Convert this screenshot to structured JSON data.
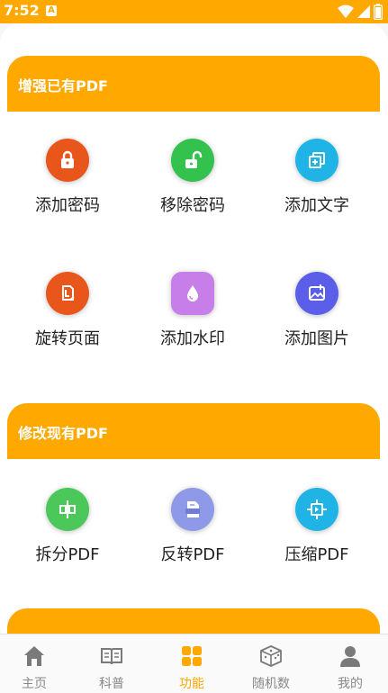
{
  "status_bar": {
    "time": "7:52",
    "notif_letter": "A"
  },
  "sections": [
    {
      "title": "增强已有PDF",
      "tiles": [
        {
          "label": "添加密码",
          "icon": "lock-icon",
          "color": "#e8561c"
        },
        {
          "label": "移除密码",
          "icon": "unlock-icon",
          "color": "#33c24d"
        },
        {
          "label": "添加文字",
          "icon": "add-text-icon",
          "color": "#1fb3e6"
        },
        {
          "label": "旋转页面",
          "icon": "rotate-page-icon",
          "color": "#e8561c"
        },
        {
          "label": "添加水印",
          "icon": "watermark-icon",
          "color": "#c87ee8"
        },
        {
          "label": "添加图片",
          "icon": "add-image-icon",
          "color": "#5b5ee8"
        }
      ]
    },
    {
      "title": "修改现有PDF",
      "tiles": [
        {
          "label": "拆分PDF",
          "icon": "split-icon",
          "color": "#4cc85a"
        },
        {
          "label": "反转PDF",
          "icon": "reverse-pdf-icon",
          "color": "#8e9ae8"
        },
        {
          "label": "压缩PDF",
          "icon": "compress-icon",
          "color": "#1fb3e6"
        }
      ]
    }
  ],
  "tab_bar": {
    "accent": "#ffa800",
    "tabs": [
      {
        "label": "主页",
        "icon": "home-icon"
      },
      {
        "label": "科普",
        "icon": "book-icon"
      },
      {
        "label": "功能",
        "icon": "grid-icon",
        "active": true
      },
      {
        "label": "随机数",
        "icon": "dice-icon"
      },
      {
        "label": "我的",
        "icon": "user-icon"
      }
    ]
  }
}
